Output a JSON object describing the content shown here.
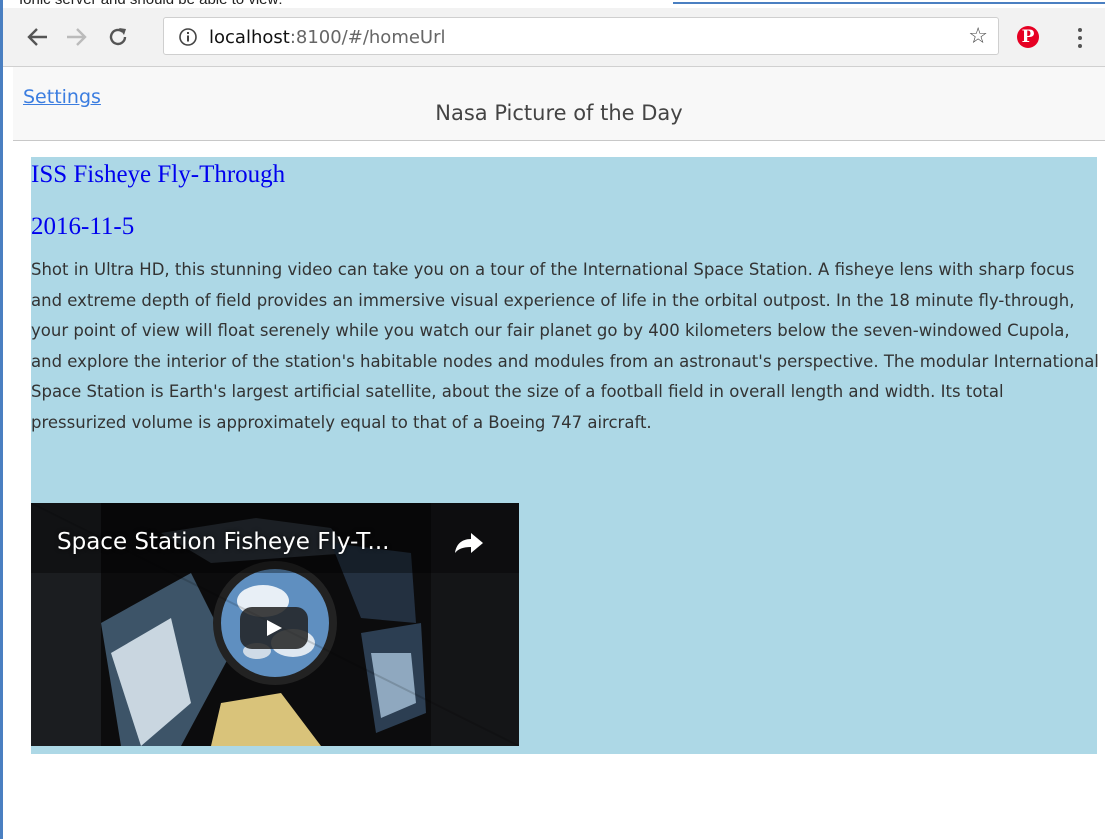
{
  "top_fragment": "Ionic server and should be able to view:",
  "browser": {
    "url_host": "localhost",
    "url_rest": ":8100/#/homeUrl",
    "icons": [
      "back-arrow-icon",
      "forward-arrow-icon",
      "reload-icon",
      "info-icon",
      "star-icon",
      "pinterest-icon",
      "menu-icon"
    ],
    "pinterest_glyph": "P"
  },
  "header": {
    "settings_label": "Settings",
    "title": "Nasa Picture of the Day"
  },
  "apod": {
    "title": "ISS Fisheye Fly-Through",
    "date": "2016-11-5",
    "description": "Shot in Ultra HD, this stunning video can take you on a tour of the International Space Station. A fisheye lens with sharp focus and extreme depth of field provides an immersive visual experience of life in the orbital outpost. In the 18 minute fly-through, your point of view will float serenely while you watch our fair planet go by 400 kilometers below the seven-windowed Cupola, and explore the interior of the station's habitable nodes and modules from an astronaut's perspective. The modular International Space Station is Earth's largest artificial satellite, about the size of a football field in overall length and width. Its total pressurized volume is approximately equal to that of a Boeing 747 aircraft."
  },
  "video": {
    "title": "Space Station Fisheye Fly-T..."
  },
  "colors": {
    "panel_bg": "#add8e6",
    "link_blue": "#0000ee",
    "settings_blue": "#3b7de0",
    "pinterest_red": "#e60023"
  }
}
